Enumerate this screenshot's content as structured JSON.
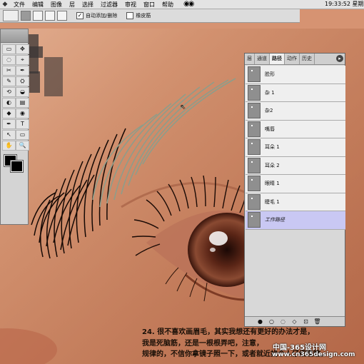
{
  "menubar": {
    "items": [
      "文件",
      "编辑",
      "图像",
      "层",
      "选择",
      "过滤器",
      "审视",
      "窗口",
      "帮助"
    ],
    "clock": "19:33:52 星期"
  },
  "options": {
    "auto_add_delete_label": "自动添加/删除",
    "auto_add_delete_checked": true,
    "rubber_band_label": "橡皮筋",
    "rubber_band_checked": false
  },
  "toolbox": {
    "tools": [
      "▭",
      "✥",
      "◌",
      "⌖",
      "✂",
      "✒",
      "✎",
      "⛭",
      "⟲",
      "◒",
      "◐",
      "▤",
      "◆",
      "◉",
      "✒",
      "T",
      "↖",
      "▭",
      "✋",
      "🔍"
    ],
    "foreground": "#000000",
    "background": "#000000"
  },
  "paths_panel": {
    "tabs": [
      "层",
      "通道",
      "路径",
      "动作",
      "历史"
    ],
    "active_tab": "路径",
    "paths": [
      {
        "label": "脸形",
        "selected": false,
        "italic": false
      },
      {
        "label": "杂 1",
        "selected": false,
        "italic": false
      },
      {
        "label": "杂2",
        "selected": false,
        "italic": false
      },
      {
        "label": "嘴唇",
        "selected": false,
        "italic": false
      },
      {
        "label": "耳朵 1",
        "selected": false,
        "italic": false
      },
      {
        "label": "耳朵 2",
        "selected": false,
        "italic": false
      },
      {
        "label": "眼睛 1",
        "selected": false,
        "italic": false
      },
      {
        "label": "睫毛 1",
        "selected": false,
        "italic": false
      },
      {
        "label": "工作路径",
        "selected": true,
        "italic": true
      }
    ],
    "footer_buttons": [
      "●",
      "○",
      "◌",
      "◇",
      "⊡",
      "🗑"
    ]
  },
  "caption": {
    "line1": "24. 很不喜欢画眉毛，其实我想还有更好的办法才是，",
    "line2": "我是死脑筋，还是一根根弄吧，注意，",
    "line3": "规律的，不信你拿镜子照一下，或者就近找个人仔细瞧瞧。"
  },
  "watermark": {
    "line1": "中国-365设计网",
    "line2": "www.cn365design.com"
  },
  "colors": {
    "skin": "#cf8a66",
    "selection": "#c9c8f3"
  }
}
